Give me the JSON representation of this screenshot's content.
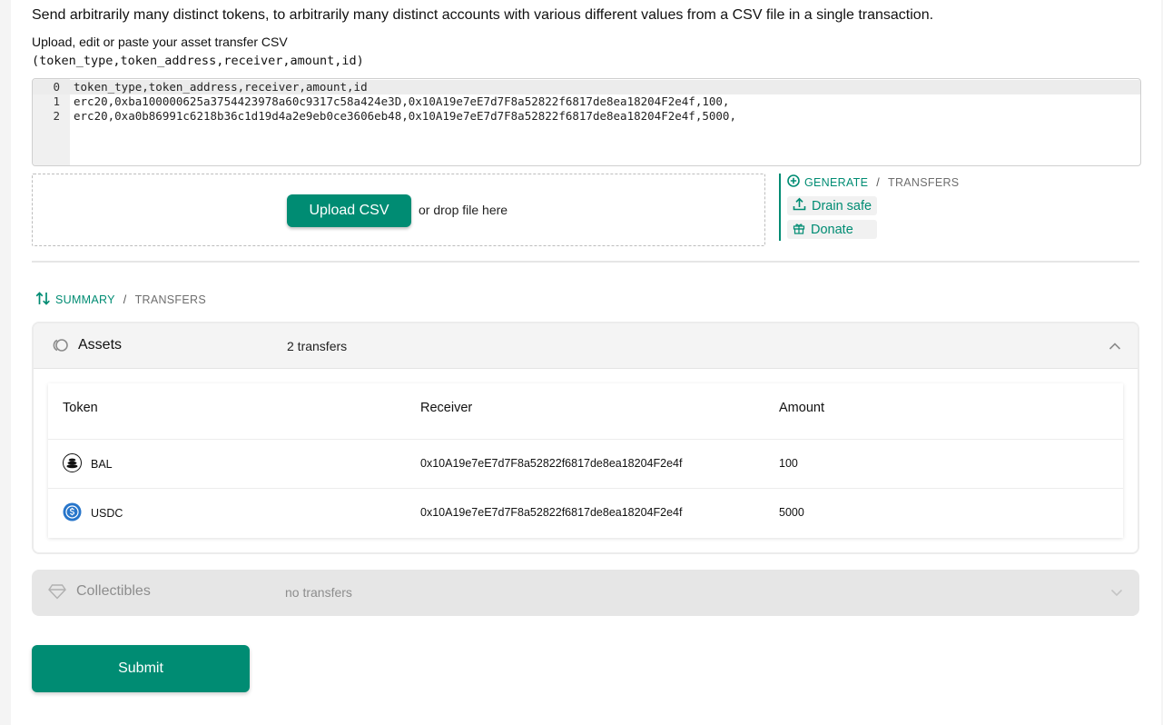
{
  "intro": "Send arbitrarily many distinct tokens, to arbitrarily many distinct accounts with various different values from a CSV file in a single transaction.",
  "upload_label": "Upload, edit or paste your asset transfer CSV",
  "csv_format": "(token_type,token_address,receiver,amount,id)",
  "editor": {
    "lines": [
      {
        "num": "0",
        "text": "token_type,token_address,receiver,amount,id"
      },
      {
        "num": "1",
        "text": "erc20,0xba100000625a3754423978a60c9317c58a424e3D,0x10A19e7eE7d7F8a52822f6817de8ea18204F2e4f,100,"
      },
      {
        "num": "2",
        "text": "erc20,0xa0b86991c6218b36c1d19d4a2e9eb0ce3606eb48,0x10A19e7eE7d7F8a52822f6817de8ea18204F2e4f,5000,"
      }
    ]
  },
  "dropzone": {
    "upload_label": "Upload CSV",
    "drop_text": "or drop file here"
  },
  "generate": {
    "active": "GENERATE",
    "separator": "/",
    "inactive": "TRANSFERS",
    "drain_label": "Drain safe",
    "donate_label": "Donate"
  },
  "summary": {
    "active": "SUMMARY",
    "separator": "/",
    "inactive": "TRANSFERS"
  },
  "assets": {
    "title": "Assets",
    "count": "2 transfers",
    "columns": [
      "Token",
      "Receiver",
      "Amount"
    ],
    "rows": [
      {
        "token": "BAL",
        "icon": "bal-token-icon",
        "receiver": "0x10A19e7eE7d7F8a52822f6817de8ea18204F2e4f",
        "amount": "100"
      },
      {
        "token": "USDC",
        "icon": "usdc-token-icon",
        "receiver": "0x10A19e7eE7d7F8a52822f6817de8ea18204F2e4f",
        "amount": "5000"
      }
    ]
  },
  "collectibles": {
    "title": "Collectibles",
    "count": "no transfers"
  },
  "submit_label": "Submit",
  "colors": {
    "accent": "#008c73",
    "panel": "#f4f4f4",
    "disabled": "#e6e6e6"
  }
}
